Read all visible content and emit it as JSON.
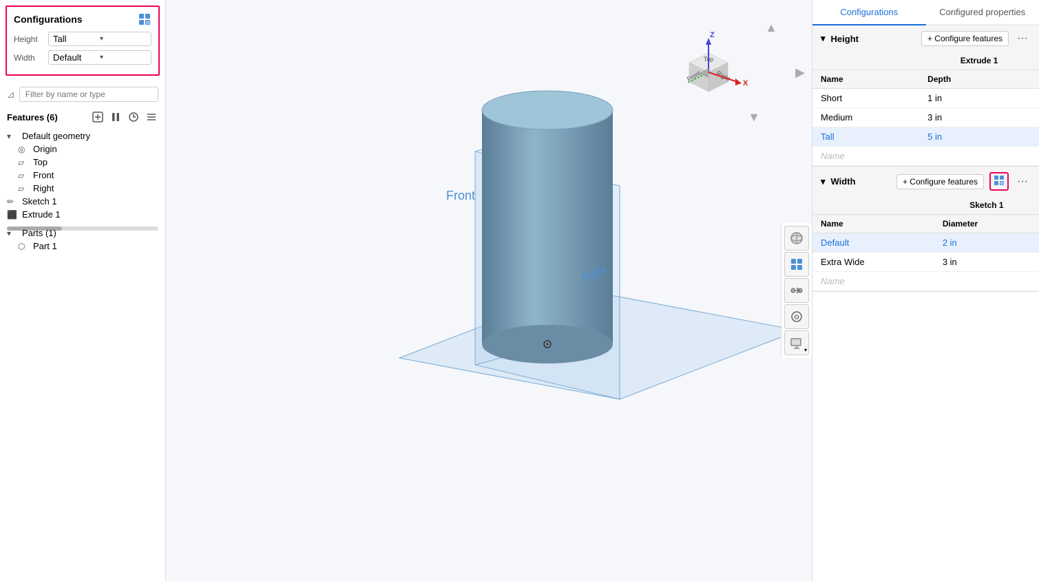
{
  "left": {
    "config_title": "Configurations",
    "config_height_label": "Height",
    "config_height_value": "Tall",
    "config_width_label": "Width",
    "config_width_value": "Default",
    "filter_placeholder": "Filter by name or type",
    "features_title": "Features (6)",
    "tree": {
      "default_geometry": "Default geometry",
      "origin": "Origin",
      "top": "Top",
      "front": "Front",
      "right": "Right",
      "sketch1": "Sketch 1",
      "extrude1": "Extrude 1"
    },
    "parts_title": "Parts (1)",
    "part1": "Part 1"
  },
  "viewport": {
    "front_label": "Front",
    "right_label": "Right"
  },
  "right": {
    "tab_configurations": "Configurations",
    "tab_configured_properties": "Configured properties",
    "height_section": "Height",
    "width_section": "Width",
    "configure_features_label": "+ Configure features",
    "height_table": {
      "header": "Extrude 1",
      "col_name": "Name",
      "col_depth": "Depth",
      "rows": [
        {
          "name": "Short",
          "value": "1 in",
          "active": false
        },
        {
          "name": "Medium",
          "value": "3 in",
          "active": false
        },
        {
          "name": "Tall",
          "value": "5 in",
          "active": true
        }
      ],
      "placeholder": "Name"
    },
    "width_table": {
      "header": "Sketch 1",
      "col_name": "Name",
      "col_diameter": "Diameter",
      "rows": [
        {
          "name": "Default",
          "value": "2 in",
          "active": true
        },
        {
          "name": "Extra Wide",
          "value": "3 in",
          "active": false
        }
      ],
      "placeholder": "Name"
    }
  }
}
